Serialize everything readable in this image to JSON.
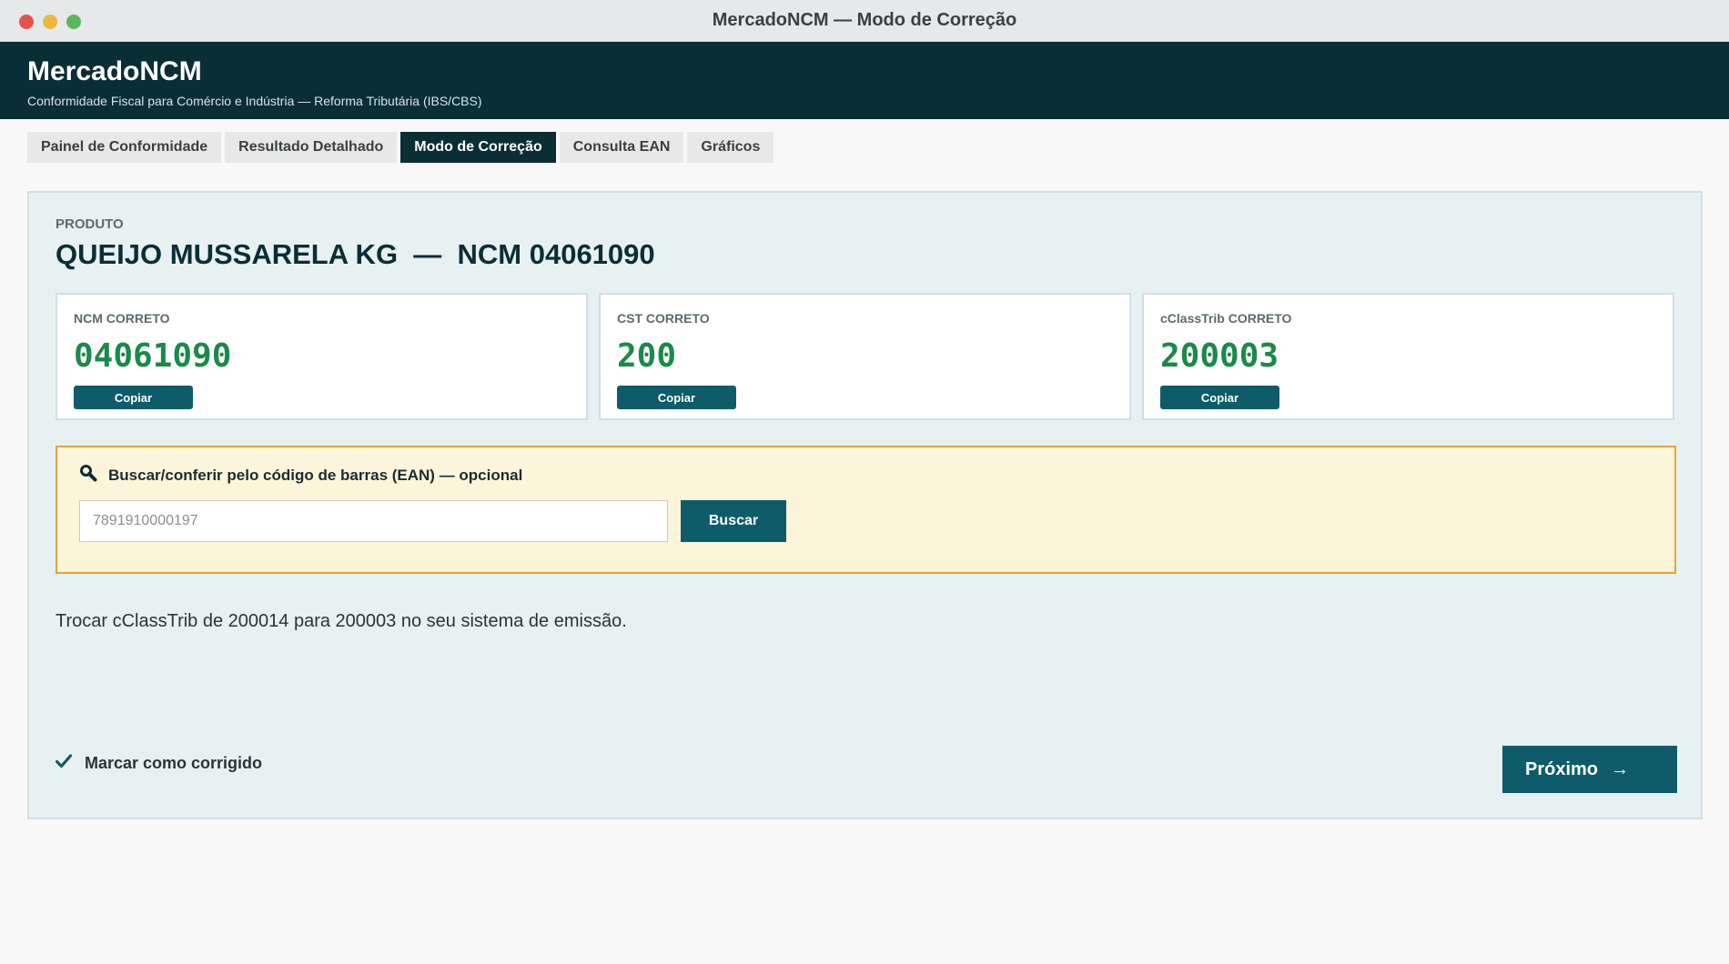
{
  "window": {
    "title": "MercadoNCM — Modo de Correção"
  },
  "app": {
    "name": "MercadoNCM",
    "subtitle": "Conformidade Fiscal para Comércio e Indústria — Reforma Tributária (IBS/CBS)"
  },
  "tabs": [
    {
      "label": "Painel de Conformidade",
      "active": false
    },
    {
      "label": "Resultado Detalhado",
      "active": false
    },
    {
      "label": "Modo de Correção",
      "active": true
    },
    {
      "label": "Consulta EAN",
      "active": false
    },
    {
      "label": "Gráficos",
      "active": false
    }
  ],
  "product": {
    "label": "PRODUTO",
    "title": "QUEIJO MUSSARELA KG  —  NCM 04061090"
  },
  "cards": [
    {
      "label": "NCM CORRETO",
      "value": "04061090",
      "copy_label": "Copiar"
    },
    {
      "label": "CST CORRETO",
      "value": "200",
      "copy_label": "Copiar"
    },
    {
      "label": "cClassTrib CORRETO",
      "value": "200003",
      "copy_label": "Copiar"
    }
  ],
  "ean": {
    "icon": "magnifier-icon",
    "title": "Buscar/conferir pelo código de barras (EAN) — opcional",
    "placeholder": "7891910000197",
    "value": "",
    "button_label": "Buscar"
  },
  "instruction": "Trocar cClassTrib de 200014 para 200003 no seu sistema de emissão.",
  "mark_corrected": {
    "label": "Marcar como corrigido",
    "icon": "checkmark-icon"
  },
  "next_button": {
    "label": "Próximo",
    "arrow": "→"
  },
  "colors": {
    "header_bg": "#0a2e36",
    "accent": "#0e5c69",
    "value_green": "#1a8a4a",
    "ean_border": "#e9a23b",
    "ean_bg": "#fdf5d9"
  }
}
